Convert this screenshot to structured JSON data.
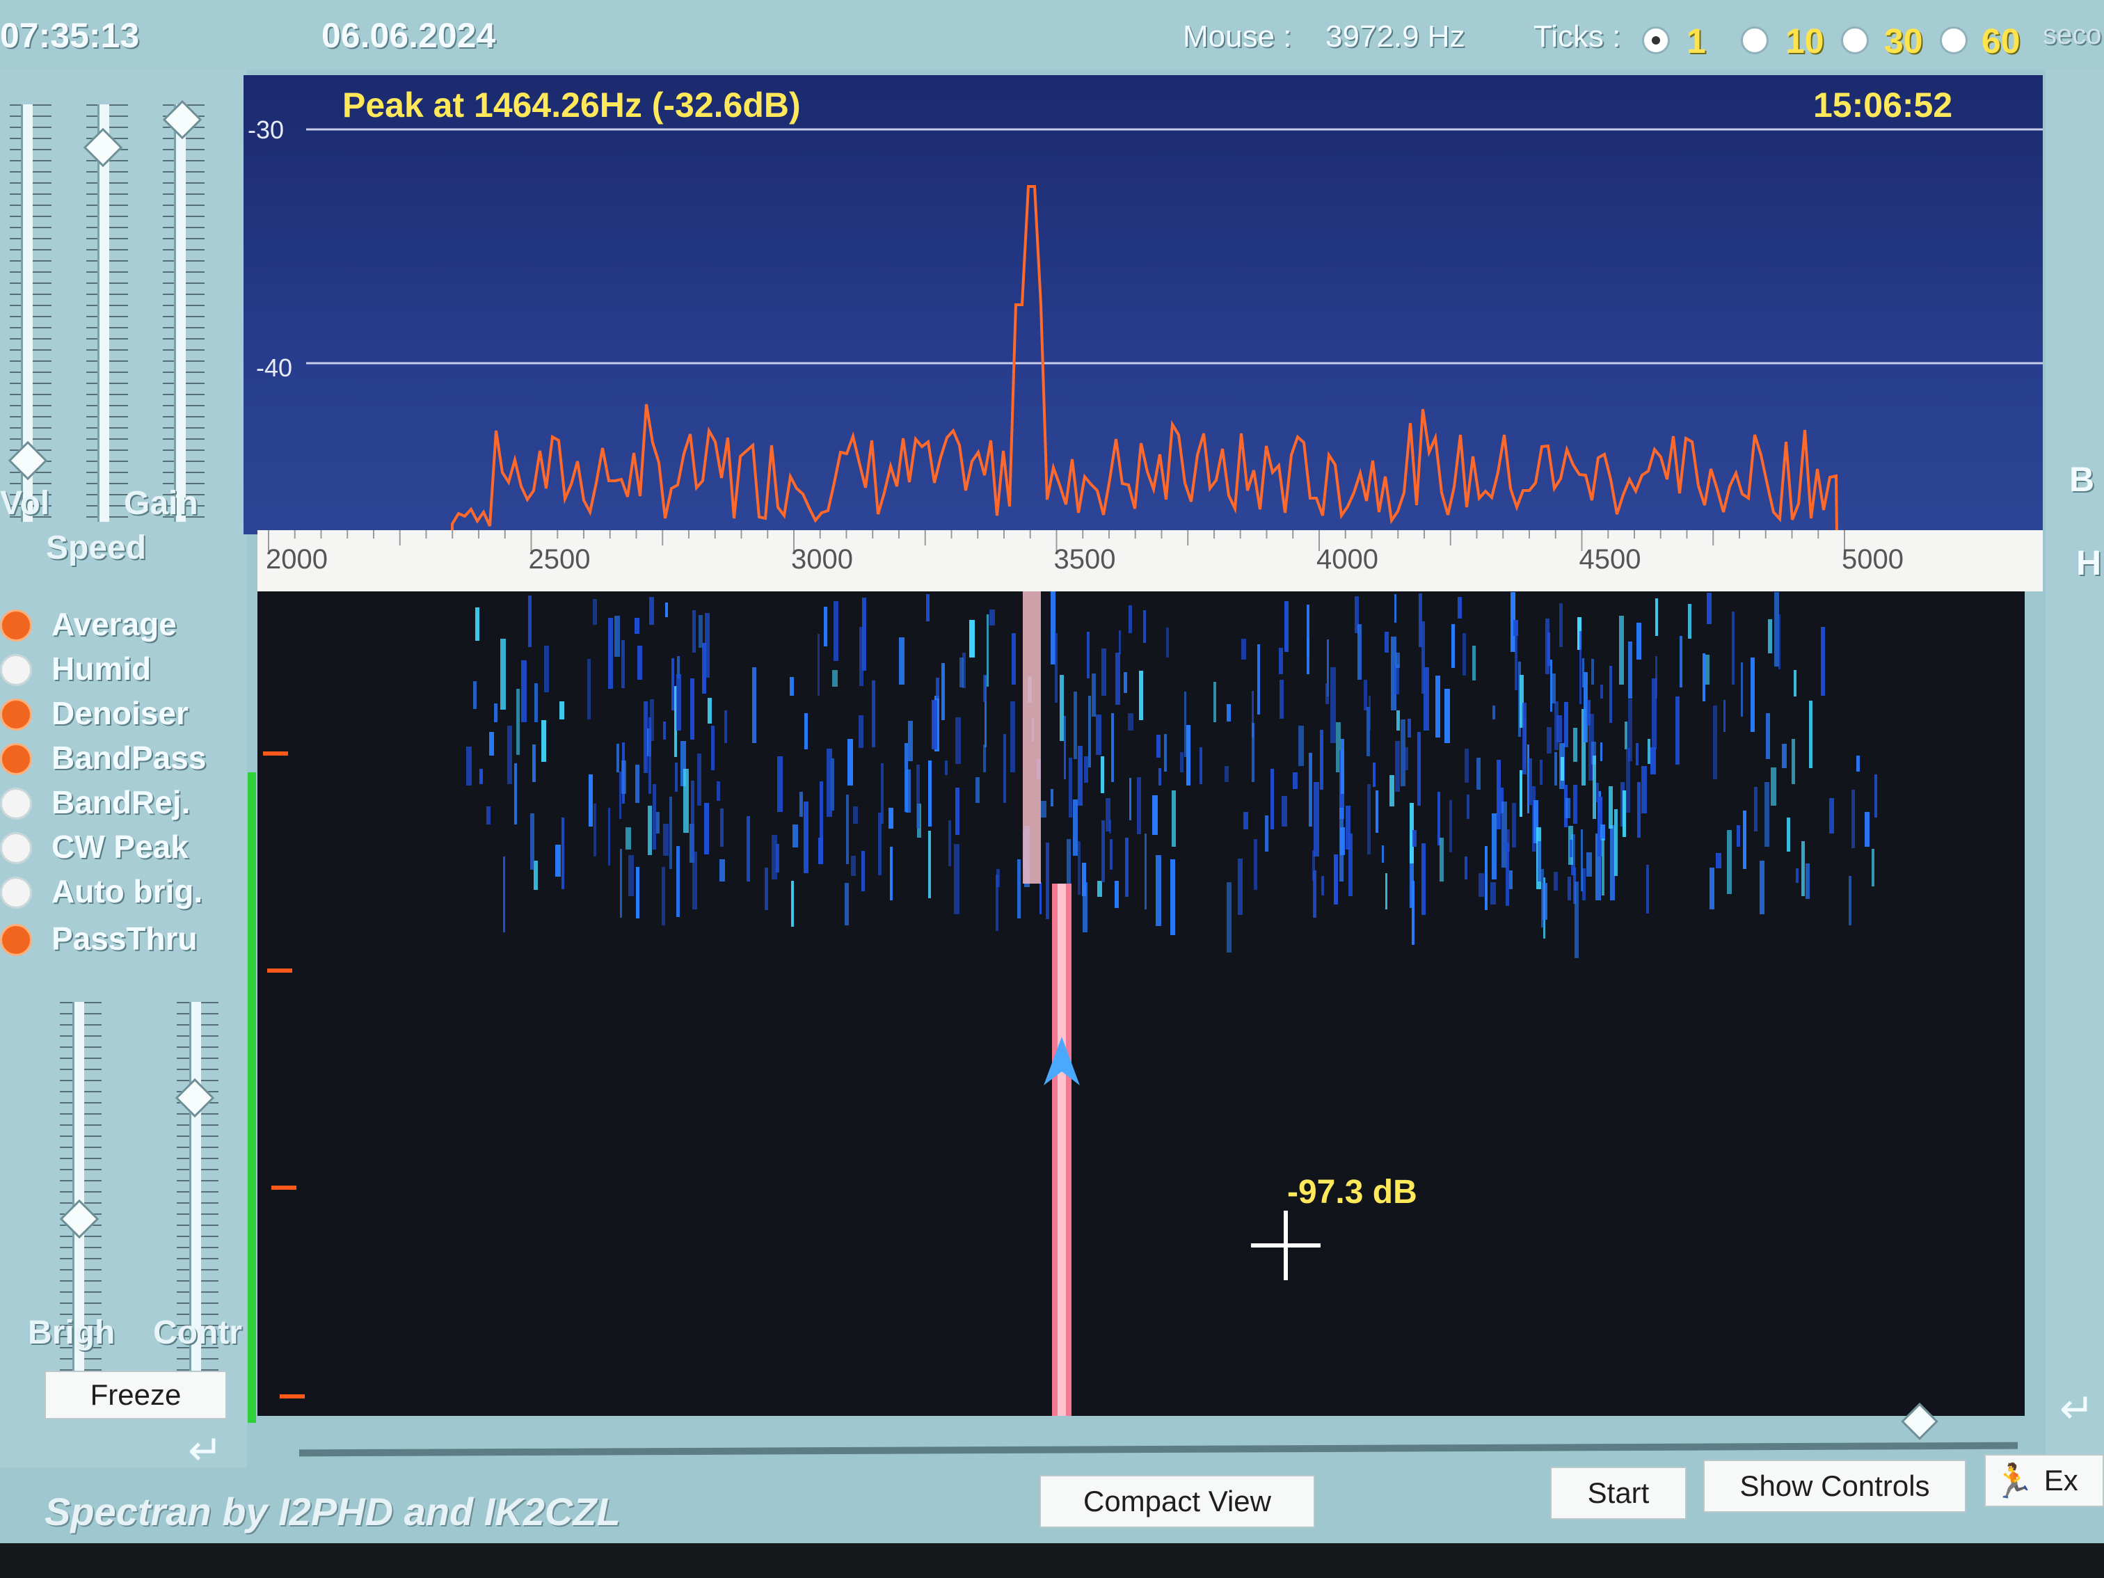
{
  "header": {
    "clock_time": "07:35:13",
    "date": "06.06.2024",
    "mouse_label": "Mouse :",
    "mouse_value": "3972.9 Hz",
    "ticks_label": "Ticks :",
    "ticks_options": [
      "1",
      "10",
      "30",
      "60"
    ],
    "ticks_selected": "1",
    "seconds_label": "seco"
  },
  "left_panel": {
    "vol_label": "Vol",
    "gain_label": "Gain",
    "speed_label": "Speed",
    "options": [
      {
        "label": "Average",
        "on": true
      },
      {
        "label": "Humid",
        "on": false
      },
      {
        "label": "Denoiser",
        "on": true
      },
      {
        "label": "BandPass",
        "on": true
      },
      {
        "label": "BandRej.",
        "on": false
      },
      {
        "label": "CW Peak",
        "on": false
      },
      {
        "label": "Auto brig.",
        "on": false
      },
      {
        "label": "PassThru",
        "on": true
      }
    ],
    "brightness_label": "Brigh",
    "contrast_label": "Contr",
    "freeze_label": "Freeze"
  },
  "spectrum": {
    "peak_text": "Peak at  1464.26Hz (-32.6dB)",
    "time": "15:06:52",
    "db_labels": [
      "-30",
      "-40"
    ],
    "accent_color": "#ff6a2c"
  },
  "freq_axis": {
    "ticks": [
      "2000",
      "2500",
      "3000",
      "3500",
      "4000",
      "4500",
      "5000"
    ]
  },
  "waterfall": {
    "cursor_readout": "-97.3 dB"
  },
  "right_edge": {
    "b_label": "B",
    "h_label": "H"
  },
  "footer": {
    "app_title": "Spectran  by I2PHD and IK2CZL",
    "compact_view": "Compact View",
    "start": "Start",
    "show_controls": "Show Controls",
    "exit": "Ex"
  }
}
